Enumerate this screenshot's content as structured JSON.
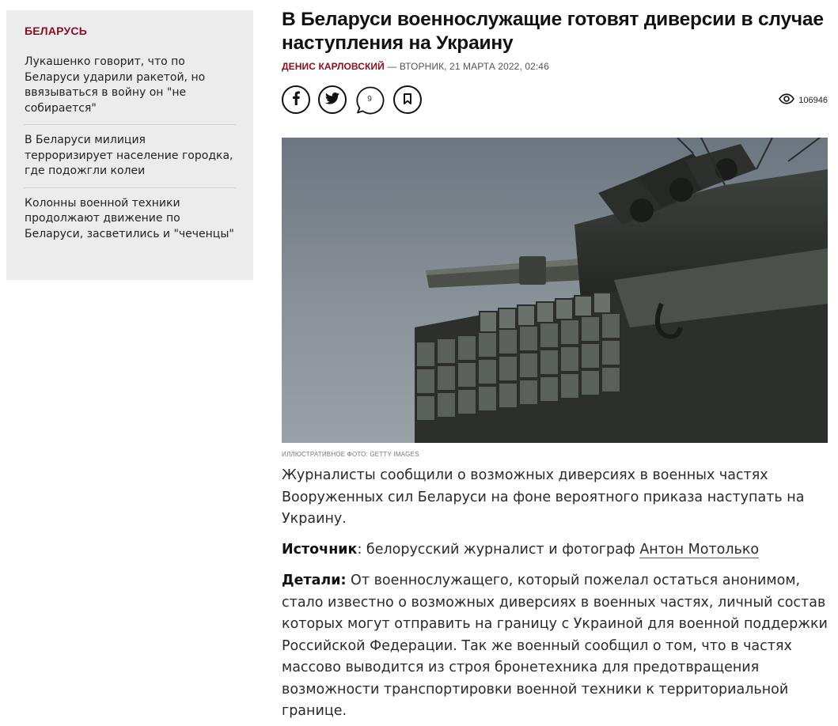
{
  "sidebar": {
    "heading": "БЕЛАРУСЬ",
    "items": [
      {
        "label": "Лукашенко говорит, что по Беларуси ударили ракетой, но ввязываться в войну он \"не собирается\""
      },
      {
        "label": "В Беларуси милиция терроризирует население городка, где подожгли колеи"
      },
      {
        "label": "Колонны военной техники продолжают движение по Беларуси, засветились и \"чеченцы\""
      }
    ]
  },
  "article": {
    "title": "В Беларуси военнослужащие готовят диверсии в случае наступления на Украину",
    "author": "ДЕНИС КАРЛОВСКИЙ",
    "date": "— ВТОРНИК, 21 МАРТА 2022, 02:46",
    "comment_count": "9",
    "views": "106946",
    "photo_caption": "ИЛЛЮСТРАТИВНОЕ ФОТО: GETTY IMAGES",
    "lead": "Журналисты сообщили о возможных диверсиях в военных частях Вооруженных сил Беларуси на фоне вероятного приказа наступать на Украину.",
    "source_label": "Источник",
    "source_text": ": белорусский журналист и фотограф ",
    "source_link": "Антон Мотолько",
    "details_label": "Детали:",
    "details_text": " От военнослужащего, который пожелал остаться анонимом, стало известно о возможных диверсиях в военных частях, личный состав которых могут отправить на границу с Украиной для военной поддержки Российской Федерации. Так же военный сообщил о том, что в частях массово выводится из строя бронетехника для предотвращения возможности транспортировки военной техники к территориальной границе."
  },
  "icons": {
    "facebook": "facebook-icon",
    "twitter": "twitter-icon",
    "comment": "comment-bubble-icon",
    "bookmark": "bookmark-icon",
    "views": "eye-icon"
  },
  "colors": {
    "accent": "#8a1020",
    "sidebar_bg": "#ececec",
    "link_underline": "#b8323f"
  }
}
